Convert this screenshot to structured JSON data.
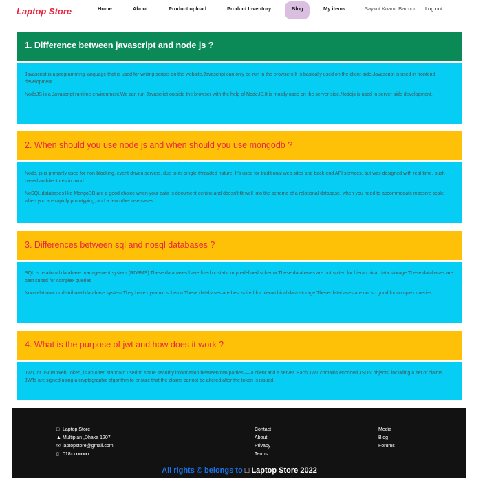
{
  "nav": {
    "brand": "Laptop Store",
    "links": [
      "Home",
      "About",
      "Product upload",
      "Product Inventory",
      "Blog",
      "My items"
    ],
    "user": "Saykot Kuamr Barmon",
    "logout": "Log out"
  },
  "cards": [
    {
      "title": "1. Difference between javascript and node js ?",
      "paragraphs": [
        "Javascript is a programming language that is used for writing scripts on the website.Javascript can only be run in the browsers.It is basically used on the client-side.Javascript is used in frontend development.",
        "NodeJS is a Javascript runtime environment.We can run Javascript outside the browser with the help of NodeJS.It is mostly used on the server-side.Nodejs is used in server-side development."
      ]
    },
    {
      "title": "2. When should you use node js and when should you use mongodb ?",
      "paragraphs": [
        "Node. js is primarily used for non-blocking, event-driven servers, due to its single-threaded nature. It's used for traditional web sites and back-end API services, but was designed with real-time, push-based architectures in mind.",
        "NoSQL databases like MongoDB are a good choice when your data is document-centric and doesn't fit well into the schema of a relational database, when you need to accommodate massive scale, when you are rapidly prototyping, and a few other use cases."
      ]
    },
    {
      "title": "3. Differences between sql and nosql databases ?",
      "paragraphs": [
        "SQL is relational database management system (RDBMS).These databases have fixed or static or predefined schema.These databases are not suited for hierarchical data storage.These databases are best suited for complex queries",
        "Non-relational or distributed database system.They have dynamic schema.These databases are best suited for hierarchical data storage.These databases are not so good for complex queries"
      ]
    },
    {
      "title": "4. What is the purpose of jwt and how does it work ?",
      "paragraphs": [
        "JWT, or JSON Web Token, is an open standard used to share security information between two parties — a client and a server. Each JWT contains encoded JSON objects, including a set of claims. JWTs are signed using a cryptographic algorithm to ensure that the claims cannot be altered after the token is issued."
      ]
    }
  ],
  "footer": {
    "contact_info": [
      {
        "icon": "laptop-icon",
        "text": "Laptop Store"
      },
      {
        "icon": "location-icon",
        "text": "Multiplan ,Dhaka 1207"
      },
      {
        "icon": "mail-icon",
        "text": "laptopstore@gmail.com"
      },
      {
        "icon": "phone-icon",
        "text": "018xxxxxxxx"
      }
    ],
    "links_col1": [
      "Contact",
      "About",
      "Privacy",
      "Terms"
    ],
    "links_col2": [
      "Media",
      "Blog",
      "Forums"
    ],
    "copyright_prefix": "All rights © belongs to",
    "copyright_brand": "Laptop Store 2022"
  }
}
